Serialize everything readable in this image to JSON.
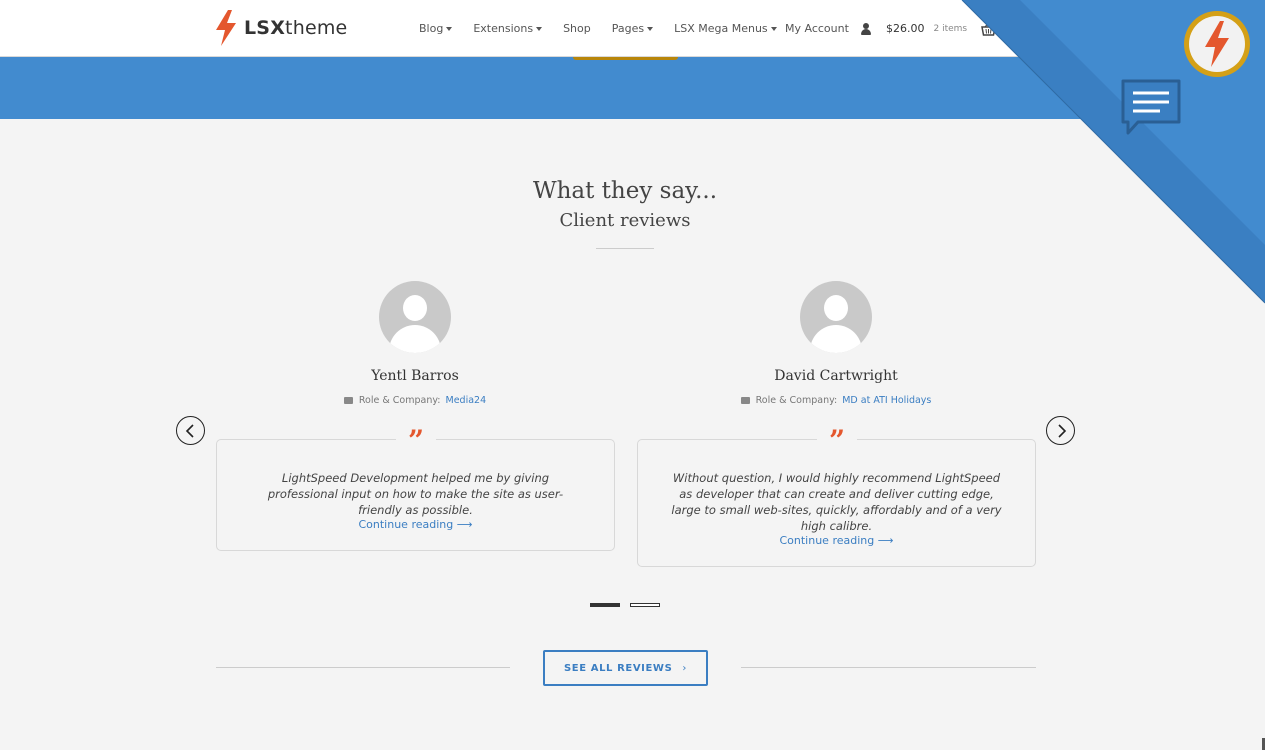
{
  "header": {
    "logo_bold": "LSX",
    "logo_light": "theme",
    "nav": [
      {
        "label": "Blog",
        "dropdown": true
      },
      {
        "label": "Extensions",
        "dropdown": true
      },
      {
        "label": "Shop",
        "dropdown": false
      },
      {
        "label": "Pages",
        "dropdown": true
      },
      {
        "label": "LSX Mega Menus",
        "dropdown": true
      }
    ],
    "account_label": "My Account",
    "cart_total": "$26.00",
    "cart_items": "2 items"
  },
  "section": {
    "title": "What they say...",
    "subtitle": "Client reviews"
  },
  "reviews": [
    {
      "name": "Yentl Barros",
      "role_label": "Role & Company:",
      "company": "Media24",
      "quote_mark": "”",
      "text": "LightSpeed Development helped me by giving professional input on how to make the site as user-friendly as possible.",
      "link": "Continue reading ⟶"
    },
    {
      "name": "David Cartwright",
      "role_label": "Role & Company:",
      "company": "MD at ATI Holidays",
      "quote_mark": "”",
      "text": "Without question, I would highly recommend LightSpeed as developer that can create and deliver cutting edge, large to small web-sites, quickly, affordably and of a very high calibre.",
      "link": "Continue reading ⟶"
    }
  ],
  "carousel": {
    "active_page": 1,
    "page_count": 2
  },
  "see_all": {
    "label": "SEE ALL REVIEWS",
    "chevron": "›"
  },
  "colors": {
    "brand_blue": "#428bcf",
    "link_blue": "#3b7ec2",
    "accent_orange": "#e4572e",
    "badge_gold": "#d4a017"
  },
  "icons": [
    "lightning-logo-icon",
    "user-icon",
    "basket-icon",
    "briefcase-icon",
    "chevron-left-icon",
    "chevron-right-icon",
    "chat-bubble-icon"
  ]
}
